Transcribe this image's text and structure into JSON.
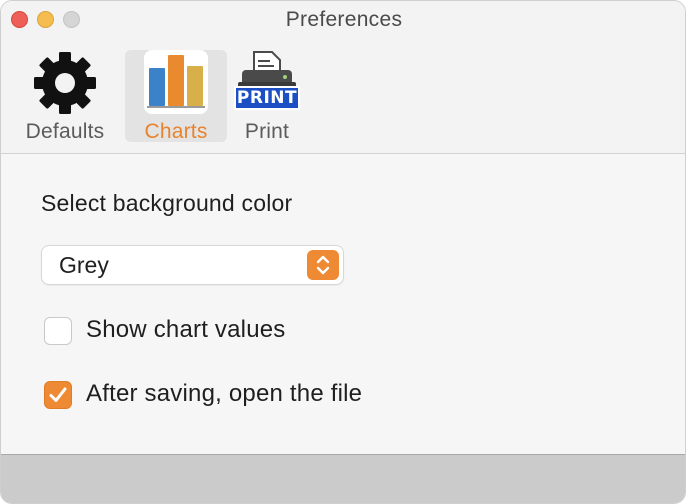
{
  "window": {
    "title": "Preferences"
  },
  "toolbar": {
    "tabs": [
      {
        "label": "Defaults",
        "icon": "gear-icon",
        "selected": false
      },
      {
        "label": "Charts",
        "icon": "bar-chart-icon",
        "selected": true
      },
      {
        "label": "Print",
        "icon": "printer-icon",
        "badge": "PRINT",
        "selected": false
      }
    ]
  },
  "content": {
    "section_title": "Select background color",
    "background_color": {
      "selected": "Grey"
    },
    "options": [
      {
        "label": "Show chart values",
        "checked": false
      },
      {
        "label": "After saving, open the file",
        "checked": true
      }
    ]
  },
  "colors": {
    "accent": "#ee8a33",
    "selected_label": "#e8832e",
    "chart_blue": "#3b82c9",
    "chart_orange": "#ea8a2f",
    "chart_gold": "#d8b04a",
    "print_badge": "#1d4fc4"
  }
}
